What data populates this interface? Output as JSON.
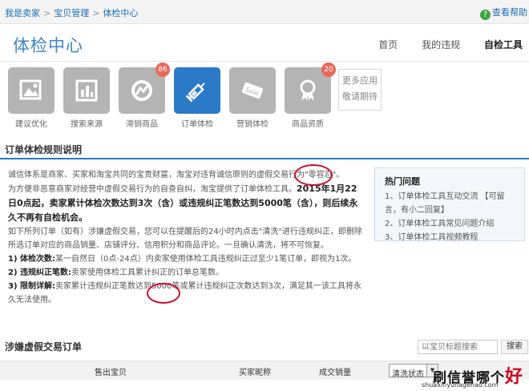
{
  "breadcrumb": {
    "item1": "我是卖家",
    "item2": "宝贝管理",
    "item3": "体检中心",
    "separator": ">"
  },
  "help": {
    "label": "查看帮助"
  },
  "header": {
    "title": "体检中心"
  },
  "nav": {
    "home": "首页",
    "violations": "我的违规",
    "self_check": "自检工具"
  },
  "tools": [
    {
      "label": "建议优化",
      "icon": "image-icon"
    },
    {
      "label": "搜索来源",
      "icon": "chart-icon"
    },
    {
      "label": "滞销商品",
      "icon": "no-sale-icon",
      "badge": "86"
    },
    {
      "label": "订单体检",
      "icon": "syringe-icon"
    },
    {
      "label": "营销体检",
      "icon": "sale-tag-icon"
    },
    {
      "label": "商品资质",
      "icon": "ribbon-icon",
      "badge": "20"
    }
  ],
  "more_apps": {
    "line1": "更多应用",
    "line2": "敬请期待"
  },
  "rules_section": {
    "title": "订单体检规则说明",
    "p1": "诚信体系是商家、买家和淘宝共同的宝贵财富，淘宝对违背诚信原则的虚假交易行为\"零容忍\"。",
    "p2a": "为方便非恶意商家对经营中虚假交易行为的自查自纠，淘宝提供了订单体检工具。",
    "p2b": "2015年1月22日0点起，卖家累计体检次数达到3次（含）或违规纠正笔数达到5000笔（含），则后续永久不再有自检机会。",
    "p3": "如下所列订单（如有）涉嫌虚假交易，您可以在提醒后的24小时内点击\"清洗\"进行违规纠正，即删除所选订单对应的商品销量、店铺评分、信用积分和商品评论。一旦确认清洗，将不可恢复。",
    "p4_label": "1) 体检次数:",
    "p4": "某一自然日（0点-24点）内卖家使用体检工具违规纠正过至少1笔订单，即视为1次。",
    "p5_label": "2) 违规纠正笔数:",
    "p5": "卖家使用体检工具累计纠正的订单总笔数。",
    "p6_label": "3) 限制详解:",
    "p6": "卖家累计违规纠正笔数达到5000笔或累计违规纠正次数达到3次，满足其一该工具将永久无法使用。"
  },
  "hot_topics": {
    "title": "热门问题",
    "items": [
      "1、订单体检工具互动交流 【可留言，有小二回复】",
      "2、订单体检工具常见问题介绍",
      "3、订单体检工具视频教程"
    ]
  },
  "orders_section": {
    "title": "涉嫌虚假交易订单",
    "search_placeholder": "以宝贝标题搜索",
    "search_button": "搜索"
  },
  "table": {
    "columns": [
      "售出宝贝",
      "买家昵称",
      "成交销量"
    ],
    "filter_select": "清洗状态"
  },
  "watermark": {
    "text": "刷信誉哪个",
    "highlight": "好",
    "url": "shuaxinyunagehao.com"
  }
}
